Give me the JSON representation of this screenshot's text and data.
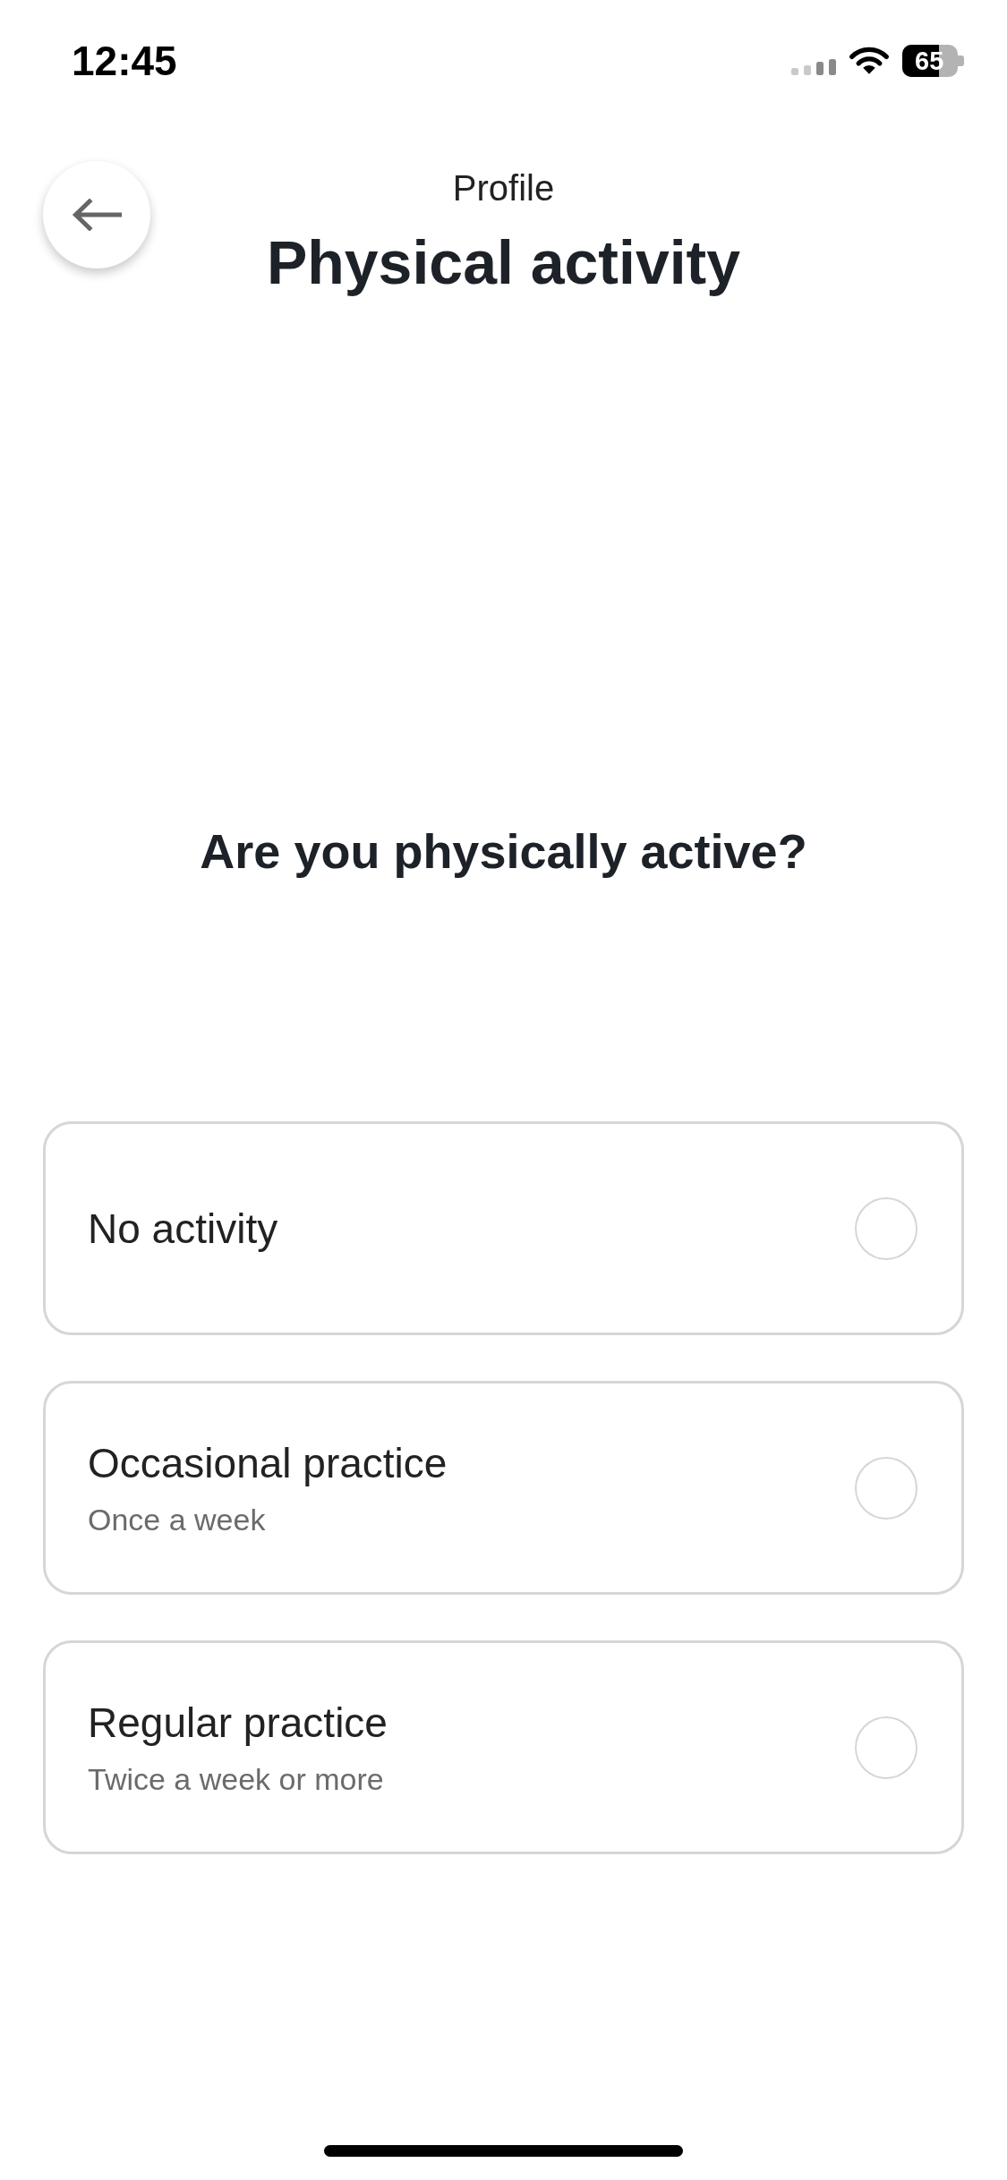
{
  "status_bar": {
    "time": "12:45",
    "battery": "65"
  },
  "header": {
    "eyebrow": "Profile",
    "title": "Physical activity"
  },
  "question": "Are you physically active?",
  "options": [
    {
      "label": "No activity",
      "selected": false
    },
    {
      "label": "Occasional practice",
      "description": "Once a week",
      "selected": false
    },
    {
      "label": "Regular practice",
      "description": "Twice a week or more",
      "selected": false
    }
  ]
}
